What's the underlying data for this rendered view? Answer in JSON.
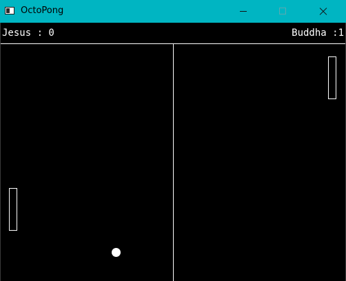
{
  "window": {
    "title": "OctoPong",
    "titlebar_color": "#00b5c2",
    "icons": [
      "app-icon",
      "minimize-icon",
      "maximize-icon",
      "close-icon"
    ]
  },
  "game": {
    "background": "#000000",
    "foreground": "#ffffff",
    "score_left": "Jesus : 0",
    "score_right": "Buddha :1"
  }
}
